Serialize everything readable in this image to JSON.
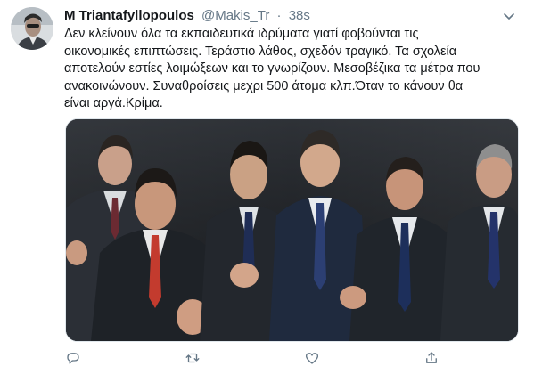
{
  "tweet": {
    "author_name": "M Triantafyllopoulos",
    "handle": "@Makis_Tr",
    "separator": "·",
    "time": "38s",
    "text_lines": [
      "Δεν κλείνουν όλα τα εκπαιδευτικά ιδρύματα γιατί φοβούνται τις",
      "οικονομικές επιπτώσεις. Τεράστιο λάθος, σχεδόν τραγικό. Τα σχολεία",
      "αποτελούν εστίες λοιμώξεων και το γνωρίζουν. Μεσοβέζικα τα μέτρα που",
      "ανακοινώνουν. Συναθροίσεις μεχρι 500 άτομα κλπ.Όταν το κάνουν θα",
      "είναι αργά.Κρίμα."
    ]
  },
  "icons": {
    "caret": "chevron-down-icon",
    "reply": "reply-icon",
    "retweet": "retweet-icon",
    "like": "heart-icon",
    "share": "share-icon"
  },
  "colors": {
    "text": "#14171a",
    "secondary": "#657786",
    "border": "#e1e8ed"
  }
}
